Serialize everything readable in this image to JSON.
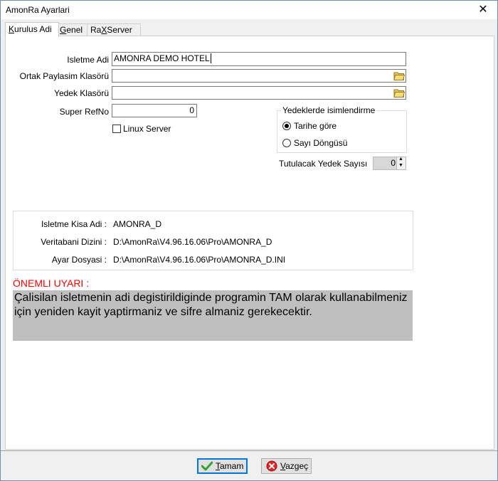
{
  "window": {
    "title": "AmonRa Ayarlari"
  },
  "tabs": [
    {
      "label_pre": "",
      "label_u": "K",
      "label_post": "urulus Adi"
    },
    {
      "label_pre": "",
      "label_u": "G",
      "label_post": "enel"
    },
    {
      "label_pre": "Ra",
      "label_u": "X",
      "label_post": "Server"
    }
  ],
  "form": {
    "isletme_adi_label": "Isletme Adi",
    "isletme_adi_value": "AMONRA DEMO HOTEL",
    "ortak_label": "Ortak Paylasim Klasörü",
    "ortak_value": "",
    "yedek_label": "Yedek Klasörü",
    "yedek_value": "",
    "super_refno_label": "Super RefNo",
    "super_refno_value": "0",
    "linux_server_label": "Linux Server",
    "linux_server_checked": false
  },
  "naming": {
    "title": "Yedeklerde isimlendirme",
    "option_date": "Tarihe göre",
    "option_cycle": "Sayı Döngüsü",
    "selected": "Tarihe göre",
    "keep_label": "Tutulacak Yedek Sayısı",
    "keep_value": "0"
  },
  "info": {
    "kisa_adi_label": "Isletme Kisa Adi :",
    "kisa_adi_value": "AMONRA_D",
    "dizin_label": "Veritabani Dizini :",
    "dizin_value": "D:\\AmonRa\\V4.96.16.06\\Pro\\AMONRA_D",
    "ayar_label": "Ayar Dosyasi :",
    "ayar_value": "D:\\AmonRa\\V4.96.16.06\\Pro\\AMONRA_D.INI"
  },
  "warning": {
    "title": "ÖNEMLI UYARI :",
    "text": "Çalisilan isletmenin adi degistirildiginde programin TAM olarak kullanabilmeniz için yeniden kayit yaptirmaniz ve sifre almaniz gerekecektir."
  },
  "buttons": {
    "ok_u": "T",
    "ok_post": "amam",
    "cancel_u": "V",
    "cancel_post": "azgeç"
  },
  "colors": {
    "accent": "#0078d7",
    "warning_red": "#ff0000",
    "warning_bg": "#bfbfbf"
  }
}
